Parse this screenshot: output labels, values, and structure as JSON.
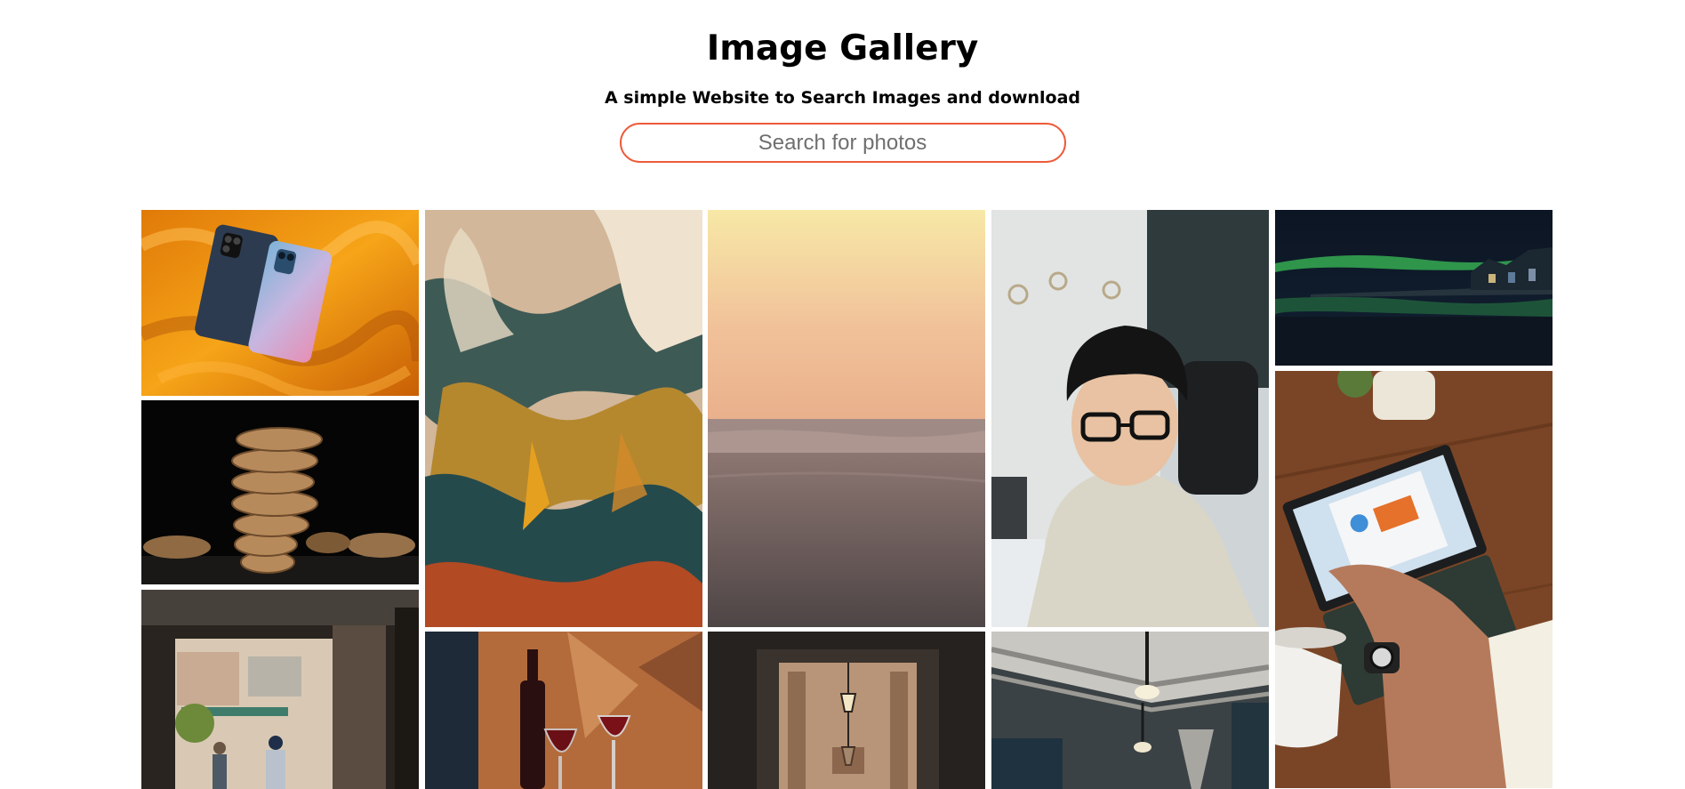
{
  "header": {
    "title": "Image Gallery",
    "subtitle": "A simple Website to Search Images and download"
  },
  "search": {
    "placeholder": "Search for photos",
    "value": "",
    "accent_color": "#ee5a3a"
  },
  "gallery": {
    "images": [
      {
        "subject": "two smartphones on orange silk",
        "icon": "phones-photo"
      },
      {
        "subject": "stacked cookies on black background",
        "icon": "cookies-photo"
      },
      {
        "subject": "doorway to street with people",
        "icon": "street-photo"
      },
      {
        "subject": "abstract paint strokes",
        "icon": "painting-photo"
      },
      {
        "subject": "wine bottle and glasses",
        "icon": "wine-photo"
      },
      {
        "subject": "ocean horizon at sunset beach",
        "icon": "beach-photo"
      },
      {
        "subject": "corridor with hanging lanterns",
        "icon": "corridor-photo"
      },
      {
        "subject": "young man with glasses at desk",
        "icon": "portrait-photo"
      },
      {
        "subject": "industrial ceiling with pipes and lamps",
        "icon": "ceiling-photo"
      },
      {
        "subject": "aurora over lakeside town at night",
        "icon": "aurora-photo"
      },
      {
        "subject": "hand using laptop tablet with coffee",
        "icon": "laptop-photo"
      }
    ]
  }
}
